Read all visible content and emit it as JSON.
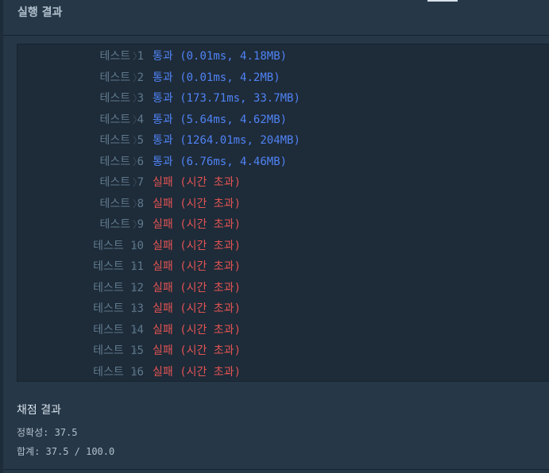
{
  "header": {
    "title": "실행 결과"
  },
  "tests": [
    {
      "label": "테스트 1",
      "result": "통과 (0.01ms, 4.18MB)",
      "status": "pass"
    },
    {
      "label": "테스트 2",
      "result": "통과 (0.01ms, 4.2MB)",
      "status": "pass"
    },
    {
      "label": "테스트 3",
      "result": "통과 (173.71ms, 33.7MB)",
      "status": "pass"
    },
    {
      "label": "테스트 4",
      "result": "통과 (5.64ms, 4.62MB)",
      "status": "pass"
    },
    {
      "label": "테스트 5",
      "result": "통과 (1264.01ms, 204MB)",
      "status": "pass"
    },
    {
      "label": "테스트 6",
      "result": "통과 (6.76ms, 4.46MB)",
      "status": "pass"
    },
    {
      "label": "테스트 7",
      "result": "실패 (시간 초과)",
      "status": "fail"
    },
    {
      "label": "테스트 8",
      "result": "실패 (시간 초과)",
      "status": "fail"
    },
    {
      "label": "테스트 9",
      "result": "실패 (시간 초과)",
      "status": "fail"
    },
    {
      "label": "테스트 10",
      "result": "실패 (시간 초과)",
      "status": "fail"
    },
    {
      "label": "테스트 11",
      "result": "실패 (시간 초과)",
      "status": "fail"
    },
    {
      "label": "테스트 12",
      "result": "실패 (시간 초과)",
      "status": "fail"
    },
    {
      "label": "테스트 13",
      "result": "실패 (시간 초과)",
      "status": "fail"
    },
    {
      "label": "테스트 14",
      "result": "실패 (시간 초과)",
      "status": "fail"
    },
    {
      "label": "테스트 15",
      "result": "실패 (시간 초과)",
      "status": "fail"
    },
    {
      "label": "테스트 16",
      "result": "실패 (시간 초과)",
      "status": "fail"
    }
  ],
  "chevron_glyph": "〉",
  "score": {
    "title": "채점 결과",
    "accuracy_label": "정확성: 37.5",
    "total_label": "합계: 37.5 / 100.0"
  },
  "colors": {
    "background": "#263747",
    "terminal_bg": "#1e2b38",
    "pass": "#4f83f5",
    "fail": "#e25454",
    "label": "#5f7a8e"
  }
}
